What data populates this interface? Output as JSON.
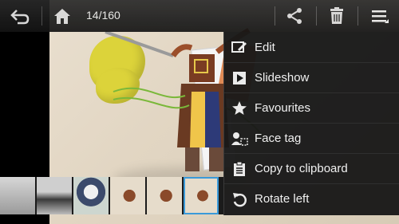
{
  "header": {
    "counter": "14/160"
  },
  "menu": {
    "items": [
      {
        "label": "Edit",
        "icon": "edit-icon"
      },
      {
        "label": "Slideshow",
        "icon": "slideshow-icon"
      },
      {
        "label": "Favourites",
        "icon": "star-icon"
      },
      {
        "label": "Face tag",
        "icon": "face-tag-icon"
      },
      {
        "label": "Copy to clipboard",
        "icon": "clipboard-icon"
      },
      {
        "label": "Rotate left",
        "icon": "rotate-left-icon"
      }
    ]
  },
  "filmstrip": {
    "selected_index": 5,
    "thumbnail_count": 6
  },
  "colors": {
    "accent": "#3a9ad9",
    "menu_bg": "#181818",
    "text": "#f0f0f0"
  }
}
